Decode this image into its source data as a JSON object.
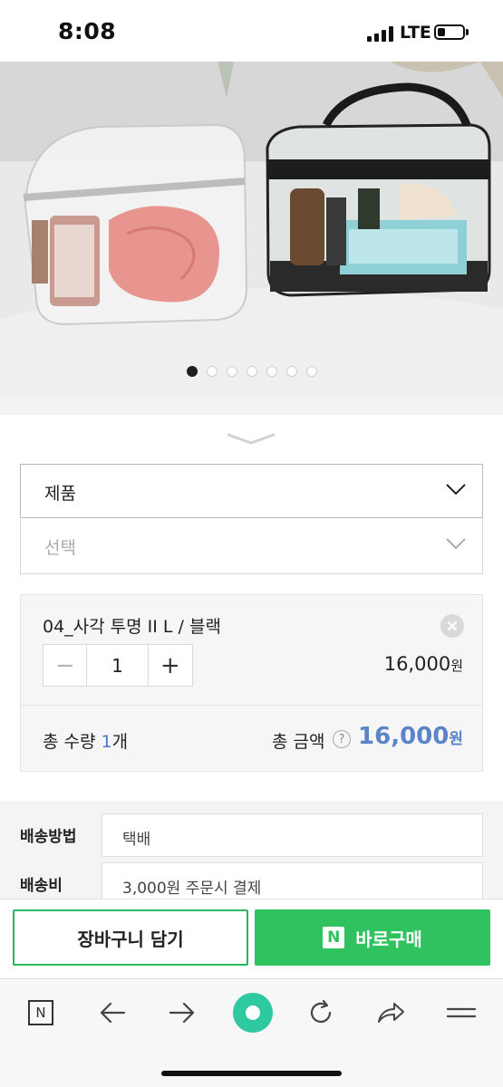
{
  "status_bar": {
    "time": "8:08",
    "network": "LTE",
    "signal_bars": 4,
    "battery_level": 0.25
  },
  "product_image": {
    "slide_count": 7,
    "active_slide": 1
  },
  "options": {
    "product_select": {
      "label": "제품"
    },
    "option_select": {
      "placeholder": "선택"
    }
  },
  "selected_item": {
    "name": "04_사각 투명 II L / 블랙",
    "quantity": "1",
    "minus": "−",
    "plus": "+",
    "price": "16,000",
    "currency": "원"
  },
  "totals": {
    "qty_label": "총 수량 ",
    "qty_value": "1",
    "qty_unit": "개",
    "amount_label": "총 금액",
    "help": "?",
    "amount": "16,000",
    "currency": "원"
  },
  "shipping": {
    "method_label": "배송방법",
    "method_value": "택배",
    "fee_label": "배송비",
    "fee_value": "3,000원 주문시 결제"
  },
  "actions": {
    "cart": "장바구니 담기",
    "buy_badge": "N",
    "buy": "바로구매"
  },
  "browser_toolbar": {
    "home_badge": "N",
    "icons": [
      "naver-home-icon",
      "back-arrow-icon",
      "forward-arrow-icon",
      "green-dot-icon",
      "reload-icon",
      "share-icon",
      "menu-icon"
    ]
  },
  "colors": {
    "naver_green": "#2fc25e",
    "price_blue": "#5b84c9",
    "qty_blue": "#4a78c8"
  }
}
